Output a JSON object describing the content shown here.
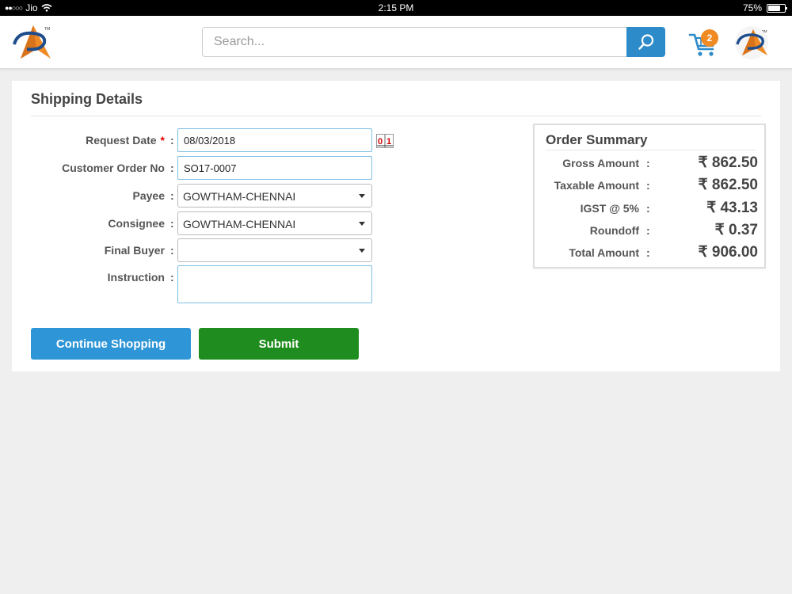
{
  "status_bar": {
    "carrier": "Jio",
    "time": "2:15 PM",
    "battery_text": "75%",
    "battery_level": 0.75
  },
  "header": {
    "search_placeholder": "Search...",
    "cart_count": "2",
    "accent_color": "#2e8bc9",
    "badge_color": "#f08a24"
  },
  "shipping": {
    "title": "Shipping Details",
    "fields": {
      "request_date": {
        "label": "Request Date",
        "required_mark": "*",
        "value": "08/03/2018"
      },
      "customer_order_no": {
        "label": "Customer Order No",
        "value": "SO17-0007"
      },
      "payee": {
        "label": "Payee",
        "value": "GOWTHAM-CHENNAI"
      },
      "consignee": {
        "label": "Consignee",
        "value": "GOWTHAM-CHENNAI"
      },
      "final_buyer": {
        "label": "Final Buyer",
        "value": ""
      },
      "instruction": {
        "label": "Instruction",
        "value": ""
      }
    },
    "colon": ":",
    "calendar_icon_text": "0 1",
    "buttons": {
      "continue_label": "Continue Shopping",
      "submit_label": "Submit",
      "continue_color": "#2e95d6",
      "submit_color": "#1e8c1e"
    }
  },
  "order_summary": {
    "title": "Order Summary",
    "colon": ":",
    "rows": [
      {
        "label": "Gross Amount",
        "value": "₹ 862.50"
      },
      {
        "label": "Taxable Amount",
        "value": "₹ 862.50"
      },
      {
        "label": "IGST @ 5%",
        "value": "₹ 43.13"
      },
      {
        "label": "Roundoff",
        "value": "₹ 0.37"
      },
      {
        "label": "Total Amount",
        "value": "₹ 906.00"
      }
    ]
  }
}
